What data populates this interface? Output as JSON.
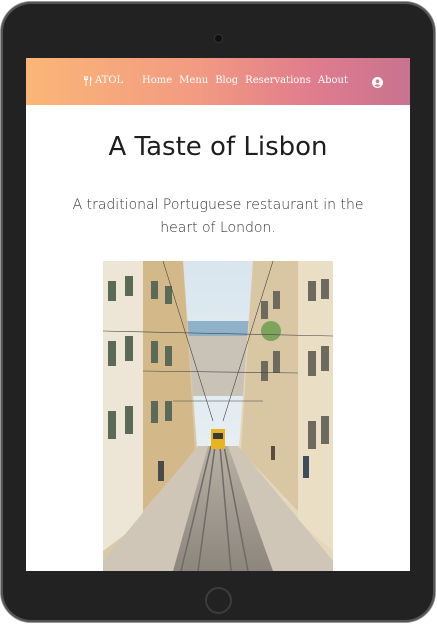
{
  "brand": {
    "name": "ATOL",
    "logo_icon": "cutlery-icon"
  },
  "nav": {
    "links": [
      "Home",
      "Menu",
      "Blog",
      "Reservations",
      "About"
    ],
    "account_icon": "user-circle-icon"
  },
  "hero": {
    "title": "A Taste of Lisbon",
    "subtitle": "A traditional Portuguese restaurant in the heart of London.",
    "image_alt": "Lisbon street with tram tracks and a yellow tram"
  },
  "colors": {
    "nav_gradient_start": "#fbb676",
    "nav_gradient_end": "#c8738f",
    "device_frame": "#222222"
  }
}
